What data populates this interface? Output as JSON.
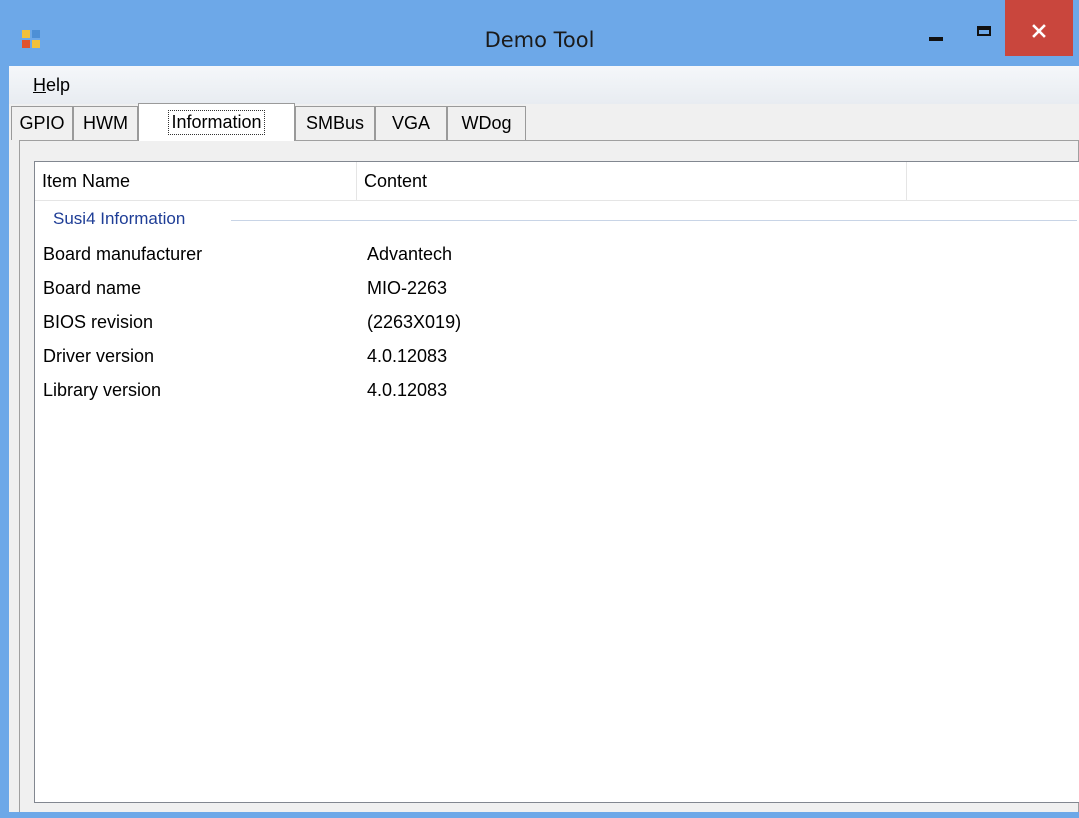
{
  "window": {
    "title": "Demo Tool",
    "app_icon": "app-icon",
    "controls": {
      "minimize_icon": "minimize-icon",
      "maximize_icon": "maximize-icon",
      "close_icon": "close-icon"
    },
    "colors": {
      "titlebar": "#6da8e8",
      "close_button": "#c9463d",
      "group_text": "#1e3d96"
    }
  },
  "menu": {
    "help_mnemonic": "H",
    "help_rest": "elp"
  },
  "tabs": [
    {
      "label": "GPIO"
    },
    {
      "label": "HWM"
    },
    {
      "label": "Information",
      "selected": true
    },
    {
      "label": "SMBus"
    },
    {
      "label": "VGA"
    },
    {
      "label": "WDog"
    }
  ],
  "list": {
    "columns": [
      "Item Name",
      "Content",
      ""
    ],
    "group": "Susi4 Information",
    "rows": [
      {
        "name": "Board manufacturer",
        "content": "Advantech"
      },
      {
        "name": "Board name",
        "content": "MIO-2263"
      },
      {
        "name": "BIOS revision",
        "content": "(2263X019)"
      },
      {
        "name": "Driver version",
        "content": "4.0.12083"
      },
      {
        "name": "Library version",
        "content": "4.0.12083"
      }
    ]
  }
}
